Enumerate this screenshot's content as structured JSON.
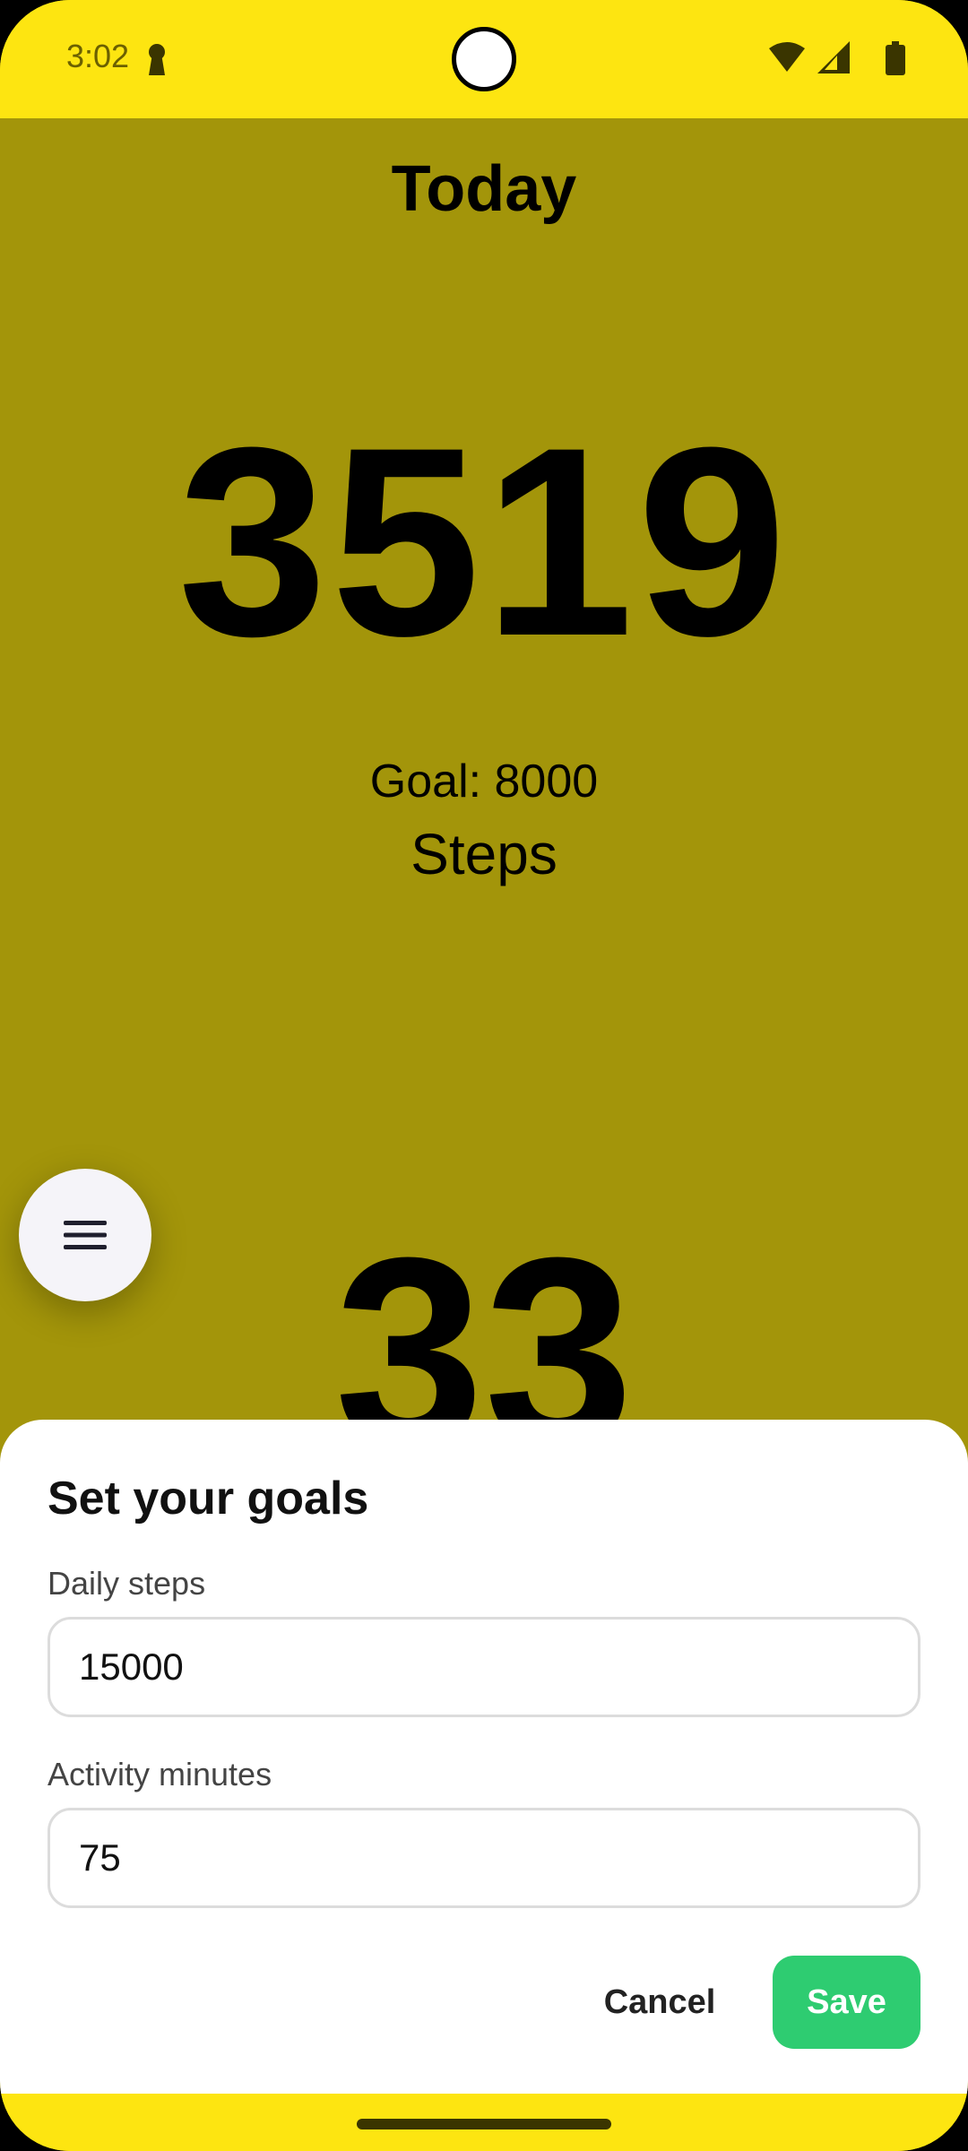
{
  "status_bar": {
    "time": "3:02",
    "icons": [
      "lock-icon",
      "wifi-icon",
      "signal-icon",
      "battery-icon"
    ]
  },
  "main": {
    "title": "Today",
    "steps_count": "3519",
    "goal_text": "Goal: 8000",
    "steps_label": "Steps",
    "second_count": "33"
  },
  "fab": {
    "icon": "menu-icon"
  },
  "sheet": {
    "title": "Set your goals",
    "daily_steps_label": "Daily steps",
    "daily_steps_value": "15000",
    "activity_minutes_label": "Activity minutes",
    "activity_minutes_value": "75",
    "cancel_label": "Cancel",
    "save_label": "Save"
  },
  "colors": {
    "status_bar": "#fde511",
    "background": "#a3950a",
    "save_button": "#2ecc71"
  }
}
